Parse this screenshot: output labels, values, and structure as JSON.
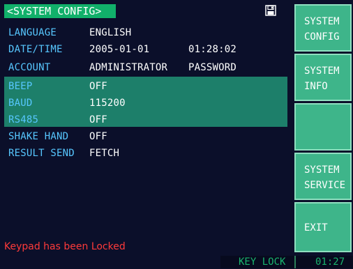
{
  "title": "<SYSTEM CONFIG>",
  "icons": {
    "save": "disk-icon"
  },
  "settings": [
    {
      "label": "LANGUAGE",
      "value": "ENGLISH",
      "value2": ""
    },
    {
      "label": "DATE/TIME",
      "value": "2005-01-01",
      "value2": "01:28:02"
    },
    {
      "label": "ACCOUNT",
      "value": "ADMINISTRATOR",
      "value2": "PASSWORD"
    },
    {
      "label": "BEEP",
      "value": "OFF",
      "value2": ""
    },
    {
      "label": "BAUD",
      "value": "115200",
      "value2": ""
    },
    {
      "label": "RS485",
      "value": "OFF",
      "value2": ""
    },
    {
      "label": "SHAKE HAND",
      "value": "OFF",
      "value2": ""
    },
    {
      "label": "RESULT SEND",
      "value": "FETCH",
      "value2": ""
    }
  ],
  "message": "Keypad has been Locked",
  "status": {
    "keylock": "KEY LOCK",
    "time": "01:27"
  },
  "softkeys": [
    {
      "line1": "SYSTEM",
      "line2": "CONFIG"
    },
    {
      "line1": "SYSTEM",
      "line2": "INFO"
    },
    {
      "line1": "",
      "line2": ""
    },
    {
      "line1": "SYSTEM",
      "line2": "SERVICE"
    },
    {
      "line1": "EXIT",
      "line2": ""
    }
  ],
  "colors": {
    "background": "#0b0f2a",
    "title_bg": "#11b06a",
    "highlight": "#1d7f6a",
    "label": "#57c7ff",
    "value": "#ffffff",
    "softkey_bg": "#3eb58a",
    "softkey_border": "#8fdfc0",
    "alert": "#ff3a3a",
    "status_text": "#19b46e"
  }
}
